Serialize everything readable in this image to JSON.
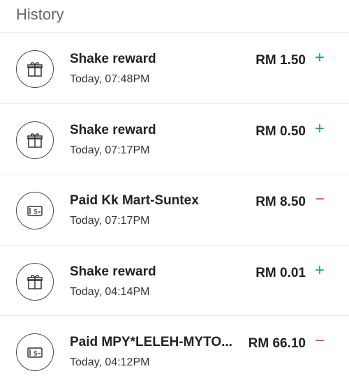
{
  "header": {
    "title": "History"
  },
  "colors": {
    "credit": "#17a08a",
    "debit": "#e8474f"
  },
  "transactions": [
    {
      "icon": "gift-icon",
      "title": "Shake reward",
      "time": "Today, 07:48PM",
      "amount": "RM 1.50",
      "sign": "+",
      "type": "credit"
    },
    {
      "icon": "gift-icon",
      "title": "Shake reward",
      "time": "Today, 07:17PM",
      "amount": "RM 0.50",
      "sign": "+",
      "type": "credit"
    },
    {
      "icon": "cash-icon",
      "title": "Paid Kk Mart-Suntex",
      "time": "Today, 07:17PM",
      "amount": "RM 8.50",
      "sign": "−",
      "type": "debit"
    },
    {
      "icon": "gift-icon",
      "title": "Shake reward",
      "time": "Today, 04:14PM",
      "amount": "RM 0.01",
      "sign": "+",
      "type": "credit"
    },
    {
      "icon": "cash-icon",
      "title": "Paid MPY*LELEH-MYTO...",
      "time": "Today, 04:12PM",
      "amount": "RM 66.10",
      "sign": "−",
      "type": "debit"
    }
  ]
}
